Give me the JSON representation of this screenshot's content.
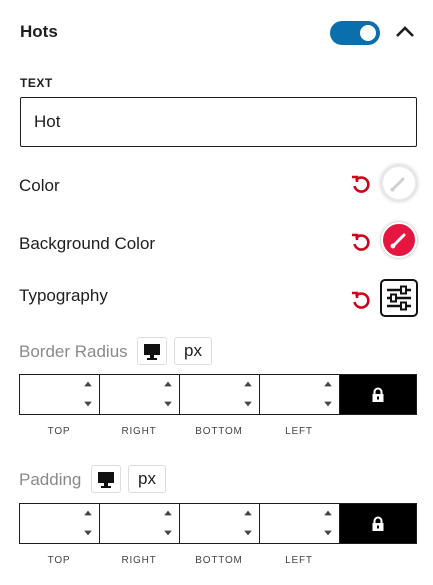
{
  "panel": {
    "title": "Hots",
    "enabled": true
  },
  "text_field": {
    "label": "TEXT",
    "value": "Hot"
  },
  "color": {
    "label": "Color",
    "value": "#ffffff"
  },
  "background_color": {
    "label": "Background Color",
    "value": "#e5163f"
  },
  "typography": {
    "label": "Typography"
  },
  "border_radius": {
    "label": "Border Radius",
    "unit": "px",
    "sides": [
      "TOP",
      "RIGHT",
      "BOTTOM",
      "LEFT"
    ]
  },
  "padding": {
    "label": "Padding",
    "unit": "px",
    "sides": [
      "TOP",
      "RIGHT",
      "BOTTOM",
      "LEFT"
    ]
  },
  "colors": {
    "toggle_on": "#0b6fad",
    "reset_red": "#d0021b",
    "accent_red": "#e5163f"
  }
}
